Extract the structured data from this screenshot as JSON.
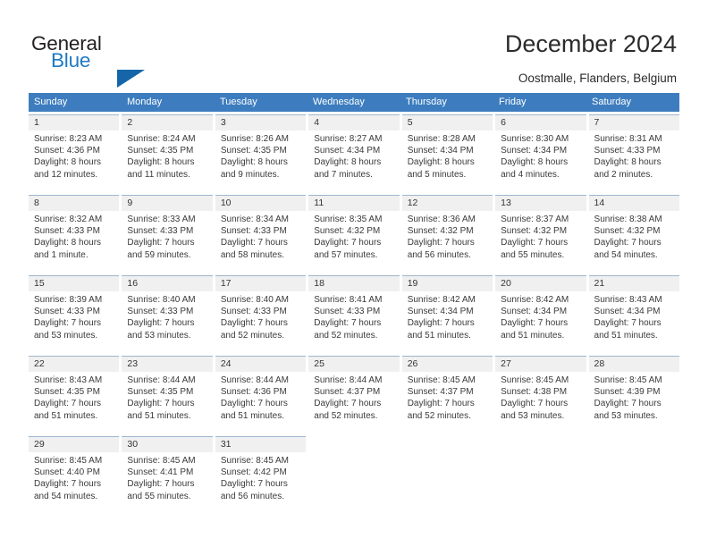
{
  "brand": {
    "name_part1": "General",
    "name_part2": "Blue",
    "accent_color": "#1e7ac3",
    "triangle_color": "#1466a8"
  },
  "header": {
    "title": "December 2024",
    "subtitle": "Oostmalle, Flanders, Belgium"
  },
  "calendar": {
    "header_bg": "#3d7dbf",
    "weekdays": [
      "Sunday",
      "Monday",
      "Tuesday",
      "Wednesday",
      "Thursday",
      "Friday",
      "Saturday"
    ],
    "weeks": [
      [
        {
          "day": "1",
          "sunrise": "Sunrise: 8:23 AM",
          "sunset": "Sunset: 4:36 PM",
          "daylight1": "Daylight: 8 hours",
          "daylight2": "and 12 minutes."
        },
        {
          "day": "2",
          "sunrise": "Sunrise: 8:24 AM",
          "sunset": "Sunset: 4:35 PM",
          "daylight1": "Daylight: 8 hours",
          "daylight2": "and 11 minutes."
        },
        {
          "day": "3",
          "sunrise": "Sunrise: 8:26 AM",
          "sunset": "Sunset: 4:35 PM",
          "daylight1": "Daylight: 8 hours",
          "daylight2": "and 9 minutes."
        },
        {
          "day": "4",
          "sunrise": "Sunrise: 8:27 AM",
          "sunset": "Sunset: 4:34 PM",
          "daylight1": "Daylight: 8 hours",
          "daylight2": "and 7 minutes."
        },
        {
          "day": "5",
          "sunrise": "Sunrise: 8:28 AM",
          "sunset": "Sunset: 4:34 PM",
          "daylight1": "Daylight: 8 hours",
          "daylight2": "and 5 minutes."
        },
        {
          "day": "6",
          "sunrise": "Sunrise: 8:30 AM",
          "sunset": "Sunset: 4:34 PM",
          "daylight1": "Daylight: 8 hours",
          "daylight2": "and 4 minutes."
        },
        {
          "day": "7",
          "sunrise": "Sunrise: 8:31 AM",
          "sunset": "Sunset: 4:33 PM",
          "daylight1": "Daylight: 8 hours",
          "daylight2": "and 2 minutes."
        }
      ],
      [
        {
          "day": "8",
          "sunrise": "Sunrise: 8:32 AM",
          "sunset": "Sunset: 4:33 PM",
          "daylight1": "Daylight: 8 hours",
          "daylight2": "and 1 minute."
        },
        {
          "day": "9",
          "sunrise": "Sunrise: 8:33 AM",
          "sunset": "Sunset: 4:33 PM",
          "daylight1": "Daylight: 7 hours",
          "daylight2": "and 59 minutes."
        },
        {
          "day": "10",
          "sunrise": "Sunrise: 8:34 AM",
          "sunset": "Sunset: 4:33 PM",
          "daylight1": "Daylight: 7 hours",
          "daylight2": "and 58 minutes."
        },
        {
          "day": "11",
          "sunrise": "Sunrise: 8:35 AM",
          "sunset": "Sunset: 4:32 PM",
          "daylight1": "Daylight: 7 hours",
          "daylight2": "and 57 minutes."
        },
        {
          "day": "12",
          "sunrise": "Sunrise: 8:36 AM",
          "sunset": "Sunset: 4:32 PM",
          "daylight1": "Daylight: 7 hours",
          "daylight2": "and 56 minutes."
        },
        {
          "day": "13",
          "sunrise": "Sunrise: 8:37 AM",
          "sunset": "Sunset: 4:32 PM",
          "daylight1": "Daylight: 7 hours",
          "daylight2": "and 55 minutes."
        },
        {
          "day": "14",
          "sunrise": "Sunrise: 8:38 AM",
          "sunset": "Sunset: 4:32 PM",
          "daylight1": "Daylight: 7 hours",
          "daylight2": "and 54 minutes."
        }
      ],
      [
        {
          "day": "15",
          "sunrise": "Sunrise: 8:39 AM",
          "sunset": "Sunset: 4:33 PM",
          "daylight1": "Daylight: 7 hours",
          "daylight2": "and 53 minutes."
        },
        {
          "day": "16",
          "sunrise": "Sunrise: 8:40 AM",
          "sunset": "Sunset: 4:33 PM",
          "daylight1": "Daylight: 7 hours",
          "daylight2": "and 53 minutes."
        },
        {
          "day": "17",
          "sunrise": "Sunrise: 8:40 AM",
          "sunset": "Sunset: 4:33 PM",
          "daylight1": "Daylight: 7 hours",
          "daylight2": "and 52 minutes."
        },
        {
          "day": "18",
          "sunrise": "Sunrise: 8:41 AM",
          "sunset": "Sunset: 4:33 PM",
          "daylight1": "Daylight: 7 hours",
          "daylight2": "and 52 minutes."
        },
        {
          "day": "19",
          "sunrise": "Sunrise: 8:42 AM",
          "sunset": "Sunset: 4:34 PM",
          "daylight1": "Daylight: 7 hours",
          "daylight2": "and 51 minutes."
        },
        {
          "day": "20",
          "sunrise": "Sunrise: 8:42 AM",
          "sunset": "Sunset: 4:34 PM",
          "daylight1": "Daylight: 7 hours",
          "daylight2": "and 51 minutes."
        },
        {
          "day": "21",
          "sunrise": "Sunrise: 8:43 AM",
          "sunset": "Sunset: 4:34 PM",
          "daylight1": "Daylight: 7 hours",
          "daylight2": "and 51 minutes."
        }
      ],
      [
        {
          "day": "22",
          "sunrise": "Sunrise: 8:43 AM",
          "sunset": "Sunset: 4:35 PM",
          "daylight1": "Daylight: 7 hours",
          "daylight2": "and 51 minutes."
        },
        {
          "day": "23",
          "sunrise": "Sunrise: 8:44 AM",
          "sunset": "Sunset: 4:35 PM",
          "daylight1": "Daylight: 7 hours",
          "daylight2": "and 51 minutes."
        },
        {
          "day": "24",
          "sunrise": "Sunrise: 8:44 AM",
          "sunset": "Sunset: 4:36 PM",
          "daylight1": "Daylight: 7 hours",
          "daylight2": "and 51 minutes."
        },
        {
          "day": "25",
          "sunrise": "Sunrise: 8:44 AM",
          "sunset": "Sunset: 4:37 PM",
          "daylight1": "Daylight: 7 hours",
          "daylight2": "and 52 minutes."
        },
        {
          "day": "26",
          "sunrise": "Sunrise: 8:45 AM",
          "sunset": "Sunset: 4:37 PM",
          "daylight1": "Daylight: 7 hours",
          "daylight2": "and 52 minutes."
        },
        {
          "day": "27",
          "sunrise": "Sunrise: 8:45 AM",
          "sunset": "Sunset: 4:38 PM",
          "daylight1": "Daylight: 7 hours",
          "daylight2": "and 53 minutes."
        },
        {
          "day": "28",
          "sunrise": "Sunrise: 8:45 AM",
          "sunset": "Sunset: 4:39 PM",
          "daylight1": "Daylight: 7 hours",
          "daylight2": "and 53 minutes."
        }
      ],
      [
        {
          "day": "29",
          "sunrise": "Sunrise: 8:45 AM",
          "sunset": "Sunset: 4:40 PM",
          "daylight1": "Daylight: 7 hours",
          "daylight2": "and 54 minutes."
        },
        {
          "day": "30",
          "sunrise": "Sunrise: 8:45 AM",
          "sunset": "Sunset: 4:41 PM",
          "daylight1": "Daylight: 7 hours",
          "daylight2": "and 55 minutes."
        },
        {
          "day": "31",
          "sunrise": "Sunrise: 8:45 AM",
          "sunset": "Sunset: 4:42 PM",
          "daylight1": "Daylight: 7 hours",
          "daylight2": "and 56 minutes."
        },
        {
          "day": "",
          "sunrise": "",
          "sunset": "",
          "daylight1": "",
          "daylight2": ""
        },
        {
          "day": "",
          "sunrise": "",
          "sunset": "",
          "daylight1": "",
          "daylight2": ""
        },
        {
          "day": "",
          "sunrise": "",
          "sunset": "",
          "daylight1": "",
          "daylight2": ""
        },
        {
          "day": "",
          "sunrise": "",
          "sunset": "",
          "daylight1": "",
          "daylight2": ""
        }
      ]
    ]
  }
}
